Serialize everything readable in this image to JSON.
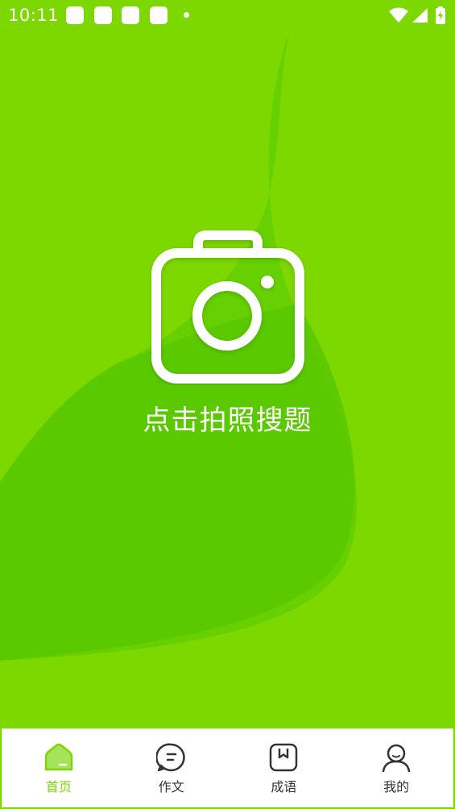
{
  "status_bar": {
    "time": "10:11"
  },
  "main": {
    "camera_label": "点击拍照搜题",
    "camera_icon": "camera-icon"
  },
  "bottom_nav": {
    "items": [
      {
        "label": "首页",
        "icon": "home-icon",
        "active": true
      },
      {
        "label": "作文",
        "icon": "chat-bubble-icon",
        "active": false
      },
      {
        "label": "成语",
        "icon": "bookmark-book-icon",
        "active": false
      },
      {
        "label": "我的",
        "icon": "user-icon",
        "active": false
      }
    ]
  },
  "colors": {
    "primary": "#7dd800",
    "blob_dark": "#5ccc00",
    "nav_active": "#7dd800",
    "nav_text": "#333333"
  }
}
